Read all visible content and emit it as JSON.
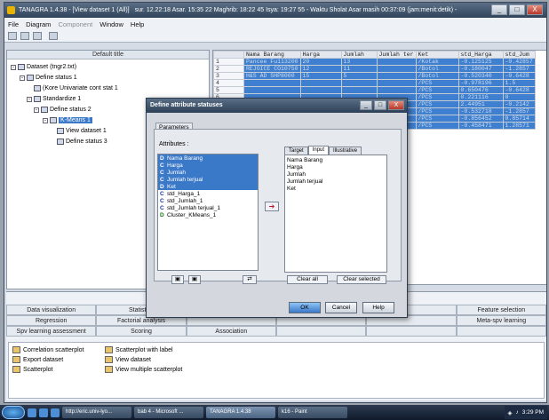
{
  "window": {
    "title": "TANAGRA 1.4.38 - [View dataset 1 (All)]",
    "title_suffix": "sur. 12.22:18 Asar. 15:35 22 Maghrib: 18:22 45 Isya: 19:27 55    - Waktu Sholat Asar masih 00:37:09 (jam:menit:detik) -",
    "controls": [
      "_",
      "□",
      "X"
    ]
  },
  "menu": [
    "File",
    "Diagram",
    "Component",
    "Window",
    "Help"
  ],
  "tree": {
    "header": "Default title",
    "nodes": [
      {
        "label": "Dataset (tngr2.txt)"
      },
      {
        "label": "Define status 1"
      },
      {
        "label": "(Kore Univariate cont stat 1"
      },
      {
        "label": "Standardize 1"
      },
      {
        "label": "Define status 2"
      },
      {
        "label": "K-Means 1"
      },
      {
        "label": "View dataset 1"
      },
      {
        "label": "Define status 3"
      }
    ]
  },
  "grid": {
    "columns": [
      "",
      "Nama Barang",
      "Harga",
      "Jumlah",
      "Jumlah ter",
      "Ket",
      "std_Harga",
      "std_Jum"
    ],
    "rows": [
      [
        "1",
        "Pancee Fu113200",
        "20",
        "13",
        "/Kotak",
        "-0.125125",
        "-0.42857"
      ],
      [
        "2",
        "REJOICE CO10750",
        "12",
        "11",
        "/Botol",
        "-0.180047",
        "-1.2857"
      ],
      [
        "3",
        "H&S AD SHP8000",
        "15",
        "5",
        "/Botol",
        "-0.520340",
        "-0.6428"
      ],
      [
        "4",
        "",
        "",
        "",
        "/PCS",
        "-0.978196",
        "1.5"
      ],
      [
        "5",
        "",
        "",
        "",
        "/PCS",
        "0.650476",
        "-0.6428"
      ],
      [
        "6",
        "",
        "",
        "",
        "/PCS",
        "0.221116",
        "0"
      ],
      [
        "7",
        "",
        "",
        "",
        "/PCS",
        "2.44951",
        "-0.2142"
      ],
      [
        "8",
        "",
        "",
        "",
        "/PCS",
        "-0.532718",
        "-1.2857"
      ],
      [
        "9",
        "",
        "",
        "",
        "/PCS",
        "-0.856452",
        "0.85714"
      ],
      [
        "10",
        "",
        "",
        "",
        "/PCS",
        "-0.458471",
        "1.28571"
      ]
    ]
  },
  "bottom_tabs": {
    "row1": [
      "Data visualization",
      "Statistics",
      "",
      "",
      "",
      "Feature selection"
    ],
    "row2": [
      "Regression",
      "Factorial analysis",
      "",
      "",
      "",
      "Meta-spv learning"
    ],
    "row3": [
      "Spv learning assessment",
      "Scoring",
      "Association",
      "",
      "",
      ""
    ]
  },
  "palette": [
    {
      "label": "Correlation scatterplot"
    },
    {
      "label": "Scatterplot with label"
    },
    {
      "label": "Export dataset"
    },
    {
      "label": "View dataset"
    },
    {
      "label": "Scatterplot"
    },
    {
      "label": "View multiple scatterplot"
    }
  ],
  "dialog": {
    "title": "Define attribute statuses",
    "tab": "Parameters",
    "attributes_label": "Attributes :",
    "attributes": [
      {
        "type": "D",
        "name": "Nama Barang",
        "selected": true
      },
      {
        "type": "C",
        "name": "Harga",
        "selected": true
      },
      {
        "type": "C",
        "name": "Jumlah",
        "selected": true
      },
      {
        "type": "C",
        "name": "Jumlah terjual",
        "selected": true
      },
      {
        "type": "D",
        "name": "Ket",
        "selected": true
      },
      {
        "type": "C",
        "name": "std_Harga_1",
        "selected": false
      },
      {
        "type": "C",
        "name": "std_Jumlah_1",
        "selected": false
      },
      {
        "type": "C",
        "name": "std_Jumlah terjual_1",
        "selected": false
      },
      {
        "type": "D",
        "name": "Cluster_KMeans_1",
        "selected": false
      }
    ],
    "right_tabs": [
      "Target",
      "Input",
      "Illustrative"
    ],
    "input_list": [
      "Nama Barang",
      "Harga",
      "Jumlah",
      "Jumlah terjual",
      "Ket"
    ],
    "clear_all": "Clear all",
    "clear_selected": "Clear selected",
    "ok": "OK",
    "cancel": "Cancel",
    "help": "Help"
  },
  "taskbar": {
    "tasks": [
      "http://eric.univ-lyo...",
      "bab 4 - Microsoft ...",
      "TANAGRA 1.4.38",
      "k16 - Paint"
    ],
    "clock": "3:29 PM"
  }
}
